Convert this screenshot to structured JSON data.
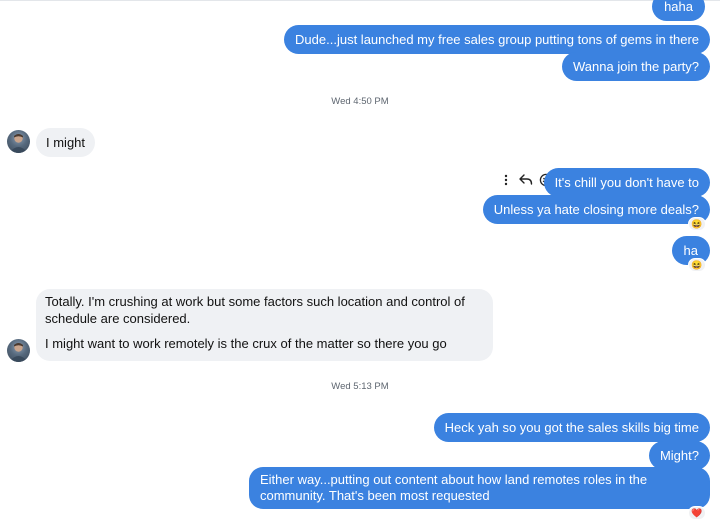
{
  "messages": {
    "m1": "haha",
    "m2": "Dude...just launched my free sales group putting tons of gems in there",
    "m3": "Wanna join the party?",
    "m4": "I might",
    "m5": "It's chill you don't have to",
    "m6": "Unless ya hate closing more deals?",
    "m7": "ha",
    "m8_line1": "Totally.  I'm crushing at work but some factors such location and control of schedule are considered.",
    "m8_line2": "I might want to work remotely is the crux of the matter so there you go",
    "m9": "Heck yah so you got the sales skills big time",
    "m10": "Might?",
    "m11": "Either way...putting out content about how land remotes roles in the community. That's been most requested"
  },
  "timestamps": {
    "t1": "Wed 4:50 PM",
    "t2": "Wed 5:13 PM"
  },
  "reactions": {
    "r1": "😆",
    "r2": "😆",
    "r3": "❤️"
  },
  "icons": {
    "more": "more-options-icon",
    "reply": "reply-icon",
    "react": "react-emoji-icon"
  },
  "colors": {
    "outgoing_bubble": "#3b82e0",
    "incoming_bubble": "#eff1f4"
  }
}
